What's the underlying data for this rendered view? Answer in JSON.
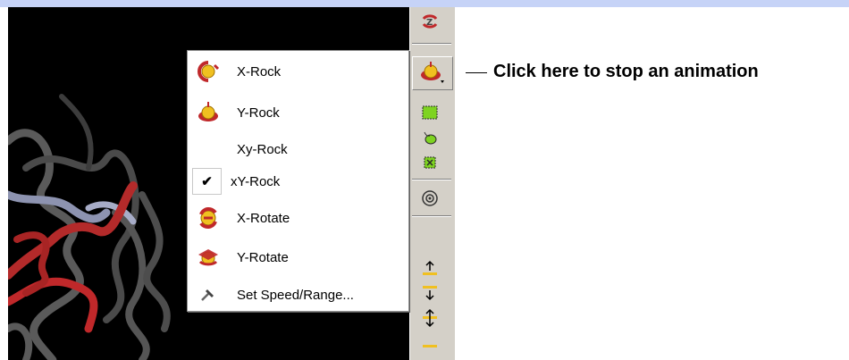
{
  "callout": {
    "text": "Click here to stop an animation"
  },
  "menu": {
    "items": [
      {
        "label": "X-Rock",
        "icon": "x-rock-icon",
        "checked": false
      },
      {
        "label": "Y-Rock",
        "icon": "y-rock-icon",
        "checked": false
      },
      {
        "label": "Xy-Rock",
        "icon": "",
        "checked": false
      },
      {
        "label": "xY-Rock",
        "icon": "",
        "checked": true
      },
      {
        "label": "X-Rotate",
        "icon": "x-rotate-icon",
        "checked": false
      },
      {
        "label": "Y-Rotate",
        "icon": "y-rotate-icon",
        "checked": false
      },
      {
        "label": "Set Speed/Range...",
        "icon": "hammer-icon",
        "checked": false
      }
    ],
    "check_glyph": "✔"
  },
  "toolbar": {
    "buttons": [
      "rotate-z-icon",
      "rock-animation-icon",
      "select-box-icon",
      "lasso-icon",
      "deselect-icon",
      "center-target-icon",
      "move-up-icon",
      "move-down-icon",
      "move-updown-icon"
    ]
  },
  "colors": {
    "top_bar": "#c6d3f7",
    "viewport_bg": "#000000",
    "toolbar_bg": "#d4d0c8",
    "accent_red": "#c0282a",
    "accent_yellow": "#f0c020"
  }
}
